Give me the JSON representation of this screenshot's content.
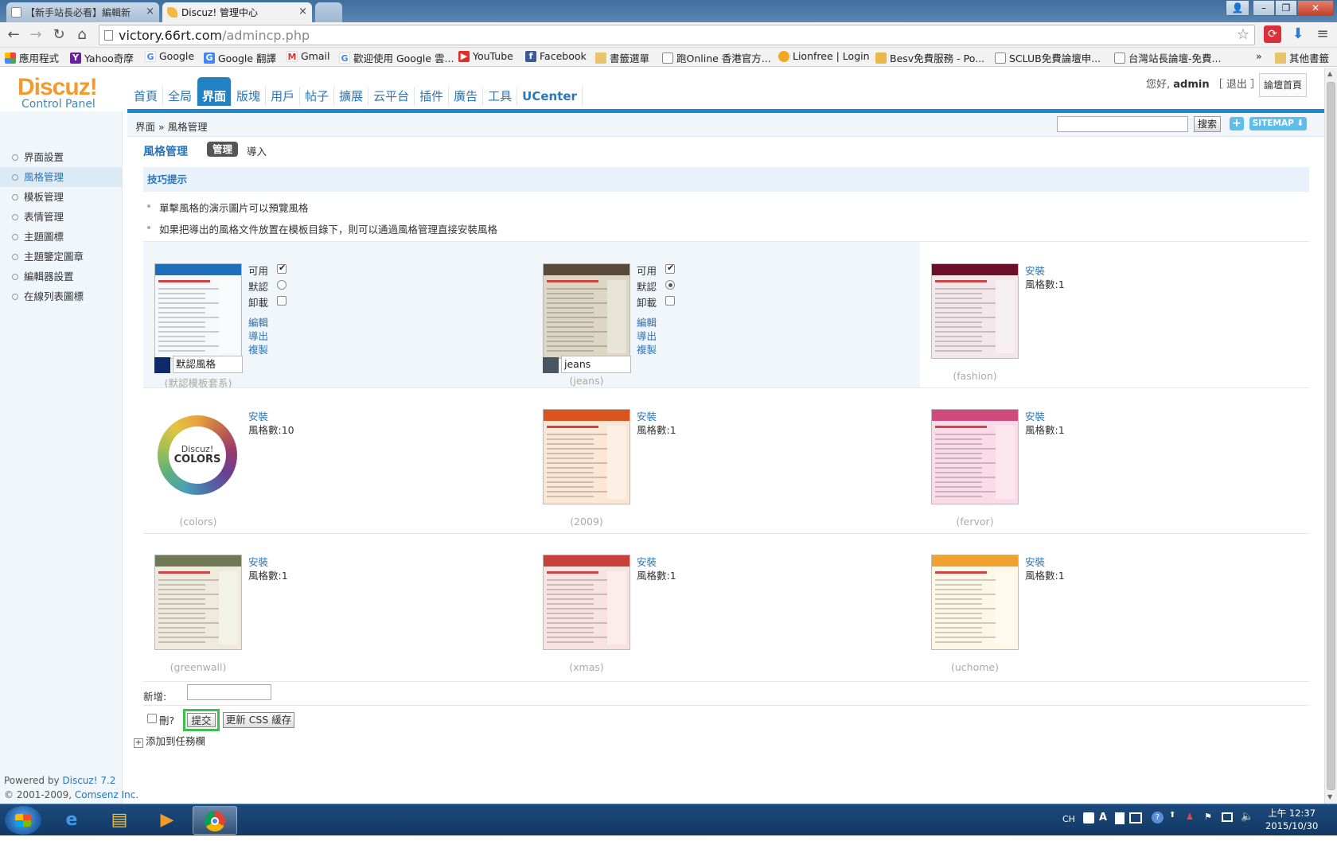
{
  "browser": {
    "tabs": [
      {
        "title": "【新手站長必看】編輯新"
      },
      {
        "title": "Discuz! 管理中心"
      }
    ],
    "url_host": "victory.66rt.com",
    "url_path": "/admincp.php",
    "bookmarks": [
      {
        "label": "應用程式"
      },
      {
        "label": "Yahoo奇摩"
      },
      {
        "label": "Google"
      },
      {
        "label": "Google 翻譯"
      },
      {
        "label": "Gmail"
      },
      {
        "label": "歡迎使用 Google 雲..."
      },
      {
        "label": "YouTube"
      },
      {
        "label": "Facebook"
      },
      {
        "label": "書籤選單"
      },
      {
        "label": "跑Online 香港官方..."
      },
      {
        "label": "Lionfree | Login"
      },
      {
        "label": "Besv免費服務 - Po..."
      },
      {
        "label": "SCLUB免費論壇申..."
      },
      {
        "label": "台灣站長論壇-免費..."
      },
      {
        "label": "»"
      },
      {
        "label": "其他書籤"
      }
    ]
  },
  "logo": {
    "main": "Discuz!",
    "sub": "Control Panel"
  },
  "nav": [
    {
      "label": "首頁"
    },
    {
      "label": "全局"
    },
    {
      "label": "界面"
    },
    {
      "label": "版塊"
    },
    {
      "label": "用戶"
    },
    {
      "label": "帖子"
    },
    {
      "label": "擴展"
    },
    {
      "label": "云平台"
    },
    {
      "label": "插件"
    },
    {
      "label": "廣告"
    },
    {
      "label": "工具"
    },
    {
      "label": "UCenter"
    }
  ],
  "user": {
    "greeting": "您好,",
    "name": "admin",
    "logout": "［ 退出 ］",
    "home": "論壇首頁"
  },
  "breadcrumb": "界面 » 風格管理",
  "search": {
    "button": "搜索",
    "plus": "+",
    "sitemap": "SITEMAP ⬇"
  },
  "sidebar": [
    {
      "label": "界面設置"
    },
    {
      "label": "風格管理"
    },
    {
      "label": "模板管理"
    },
    {
      "label": "表情管理"
    },
    {
      "label": "主題圖標"
    },
    {
      "label": "主題鑒定圖章"
    },
    {
      "label": "編輯器設置"
    },
    {
      "label": "在線列表圖標"
    }
  ],
  "powered": {
    "line1_prefix": "Powered by ",
    "line1_link": "Discuz! 7.2",
    "line2_prefix": "© 2001-2009, ",
    "line2_link": "Comsenz Inc."
  },
  "page": {
    "title": "風格管理",
    "tab_manage": "管理",
    "tab_import": "導入"
  },
  "tips": {
    "header": "技巧提示",
    "items": [
      "單擊風格的演示圖片可以預覽風格",
      "如果把導出的風格文件放置在模板目錄下，則可以通過風格管理直接安裝風格"
    ]
  },
  "styles": [
    {
      "caption": "(默認模板套系)",
      "name": "默認風格",
      "available_label": "可用",
      "default_label": "默認",
      "uninstall_label": "卸載",
      "available": true,
      "is_default": false,
      "edit": "編輯",
      "export": "導出",
      "copy": "複製",
      "swatch": "#0e2a6b",
      "header_color": "#1e6fb8",
      "body_color": "#f6f9fc"
    },
    {
      "caption": "(jeans)",
      "name": "jeans",
      "available_label": "可用",
      "default_label": "默認",
      "uninstall_label": "卸載",
      "available": true,
      "is_default": true,
      "edit": "編輯",
      "export": "導出",
      "copy": "複製",
      "swatch": "#4a5563",
      "header_color": "#5a4a3a",
      "body_color": "#ddd6c4"
    },
    {
      "caption": "(fashion)",
      "install": "安裝",
      "count": "風格數:1",
      "header_color": "#6b0f2b",
      "body_color": "#f4e7ec"
    },
    {
      "caption": "(colors)",
      "install": "安裝",
      "count": "風格數:10",
      "wheel_top": "Discuz!",
      "wheel_bottom": "COLORS"
    },
    {
      "caption": "(2009)",
      "install": "安裝",
      "count": "風格數:1",
      "header_color": "#d9541e",
      "body_color": "#fbe7d4"
    },
    {
      "caption": "(fervor)",
      "install": "安裝",
      "count": "風格數:1",
      "header_color": "#d14a7c",
      "body_color": "#fbdbe7"
    },
    {
      "caption": "(greenwall)",
      "install": "安裝",
      "count": "風格數:1",
      "header_color": "#6e7a55",
      "body_color": "#efeadb"
    },
    {
      "caption": "(xmas)",
      "install": "安裝",
      "count": "風格數:1",
      "header_color": "#c8403a",
      "body_color": "#f8e3e2"
    },
    {
      "caption": "(uchome)",
      "install": "安裝",
      "count": "風格數:1",
      "header_color": "#f0a12e",
      "body_color": "#fdf7e6"
    }
  ],
  "form": {
    "add_label": "新增:",
    "delete_label": "刪?",
    "submit": "提交",
    "update_css": "更新 CSS 緩存",
    "taskbar_add": "添加到任務欄"
  },
  "taskbar": {
    "tray_lang": "CH",
    "time": "上午 12:37",
    "date": "2015/10/30"
  }
}
